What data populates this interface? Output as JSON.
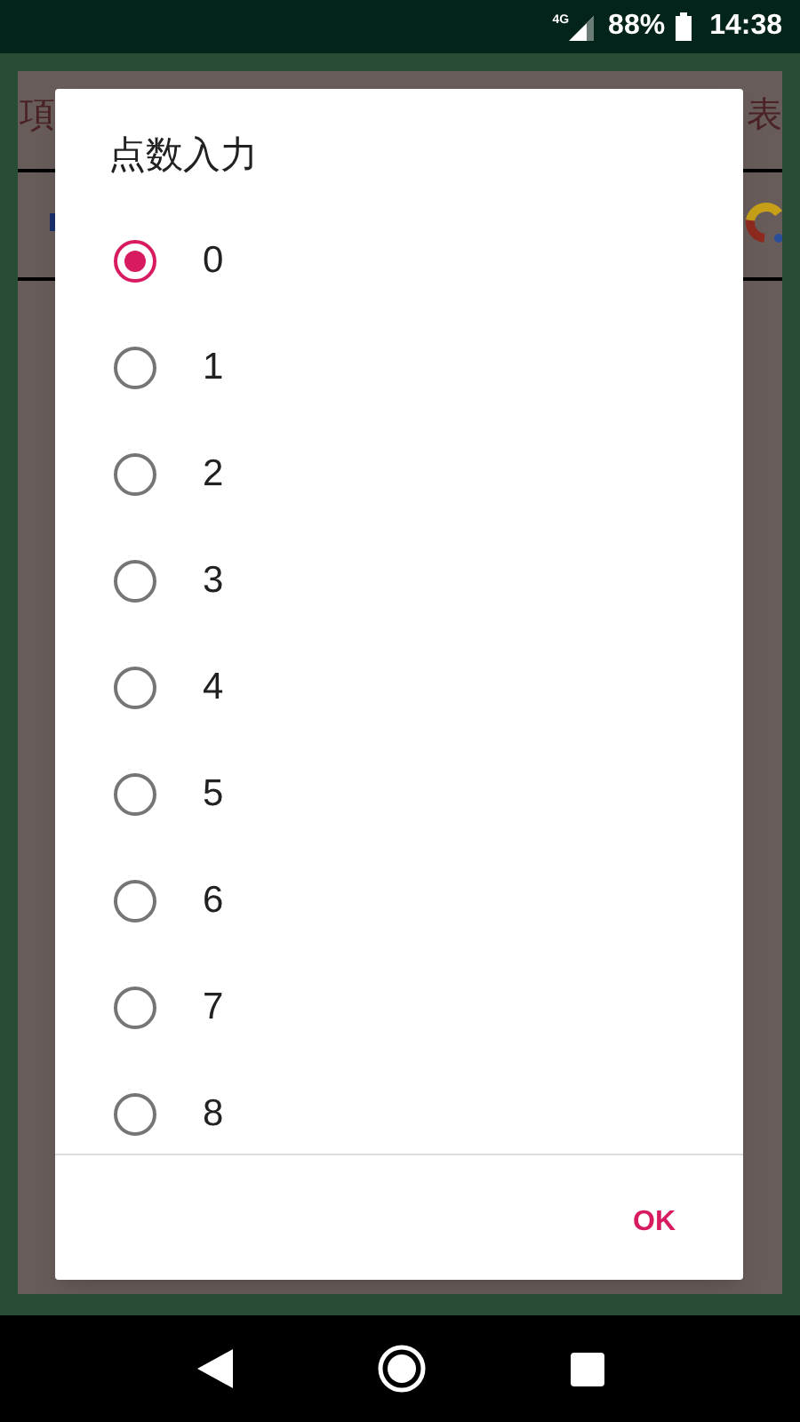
{
  "status_bar": {
    "network": "4G",
    "battery": "88%",
    "time": "14:38"
  },
  "background": {
    "left_text": "項",
    "right_text": "表"
  },
  "dialog": {
    "title": "点数入力",
    "options": [
      {
        "label": "0",
        "selected": true
      },
      {
        "label": "1",
        "selected": false
      },
      {
        "label": "2",
        "selected": false
      },
      {
        "label": "3",
        "selected": false
      },
      {
        "label": "4",
        "selected": false
      },
      {
        "label": "5",
        "selected": false
      },
      {
        "label": "6",
        "selected": false
      },
      {
        "label": "7",
        "selected": false
      },
      {
        "label": "8",
        "selected": false
      }
    ],
    "ok_button": "OK"
  }
}
